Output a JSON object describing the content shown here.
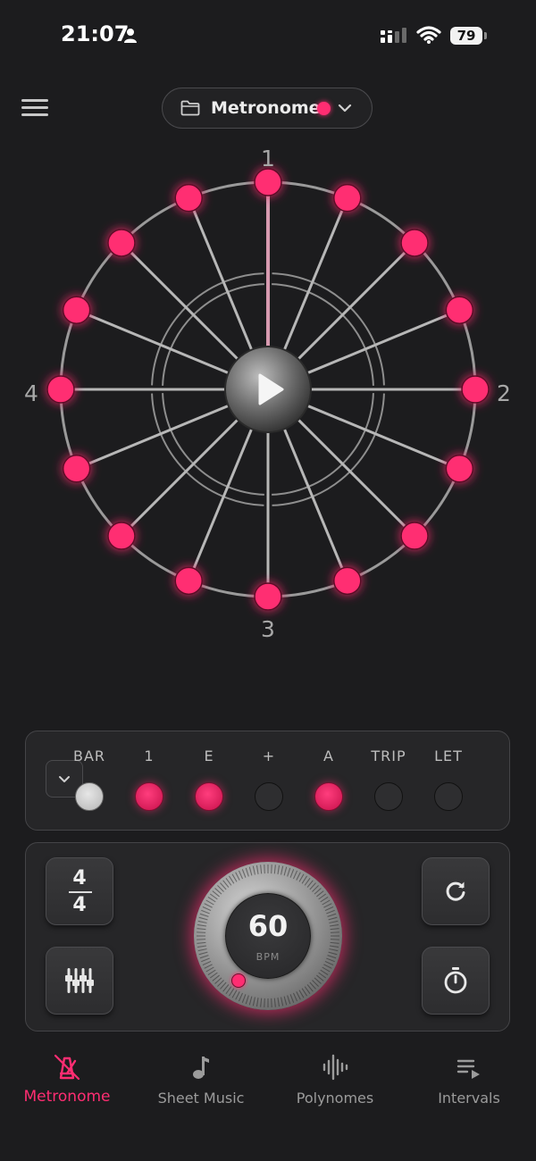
{
  "status_bar": {
    "time": "21:07",
    "battery": "79"
  },
  "header": {
    "title": "Metronome",
    "accent_color": "#ff2d72"
  },
  "wheel": {
    "beat_labels": [
      "1",
      "2",
      "3",
      "4"
    ],
    "subdivisions_per_beat": 4,
    "active_color": "#ff2d72"
  },
  "subdivision_panel": {
    "items": [
      {
        "label": "BAR",
        "state": "white"
      },
      {
        "label": "1",
        "state": "on"
      },
      {
        "label": "E",
        "state": "on"
      },
      {
        "label": "+",
        "state": "off"
      },
      {
        "label": "A",
        "state": "on"
      },
      {
        "label": "TRIP",
        "state": "off"
      },
      {
        "label": "LET",
        "state": "off"
      }
    ]
  },
  "controls": {
    "time_signature": {
      "top": "4",
      "bottom": "4"
    },
    "bpm": {
      "value": "60",
      "label": "BPM"
    }
  },
  "tabs": [
    {
      "label": "Metronome",
      "icon": "metronome-icon",
      "active": true
    },
    {
      "label": "Sheet Music",
      "icon": "music-note-icon",
      "active": false
    },
    {
      "label": "Polynomes",
      "icon": "waveform-icon",
      "active": false
    },
    {
      "label": "Intervals",
      "icon": "playlist-icon",
      "active": false
    }
  ]
}
